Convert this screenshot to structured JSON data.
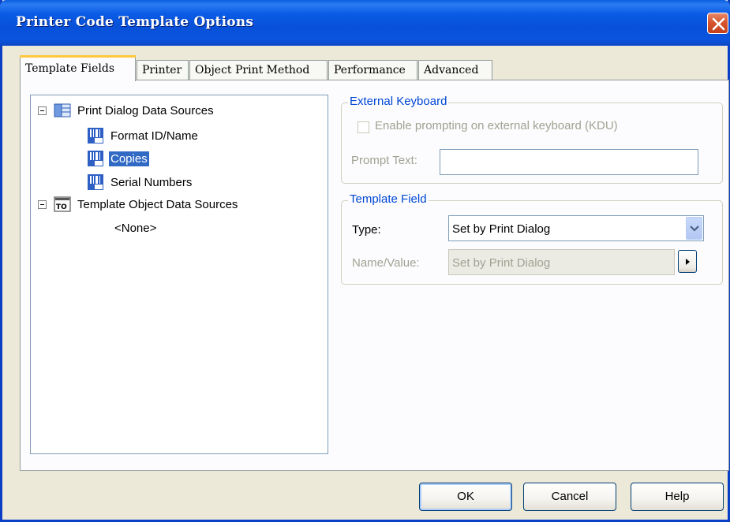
{
  "window": {
    "title": "Printer Code Template Options"
  },
  "tabs": [
    {
      "label": "Template Fields",
      "active": true
    },
    {
      "label": "Printer"
    },
    {
      "label": "Object Print Method"
    },
    {
      "label": "Performance"
    },
    {
      "label": "Advanced"
    }
  ],
  "tree": {
    "root1": {
      "label": "Print Dialog Data Sources",
      "children": [
        "Format ID/Name",
        "Copies",
        "Serial Numbers"
      ],
      "selected": "Copies"
    },
    "root2": {
      "label": "Template Object Data Sources",
      "children": [
        "<None>"
      ]
    }
  },
  "external_keyboard": {
    "legend": "External Keyboard",
    "checkbox_label": "Enable prompting on external keyboard (KDU)",
    "prompt_label": "Prompt Text:",
    "prompt_value": ""
  },
  "template_field": {
    "legend": "Template Field",
    "type_label": "Type:",
    "type_value": "Set by Print Dialog",
    "name_value_label": "Name/Value:",
    "name_value_value": "Set by Print Dialog"
  },
  "buttons": {
    "ok": "OK",
    "cancel": "Cancel",
    "help": "Help"
  },
  "colors": {
    "titlebar": "#0a54de",
    "legend": "#0046d5",
    "selection": "#316ac5",
    "close": "#d8552e"
  }
}
